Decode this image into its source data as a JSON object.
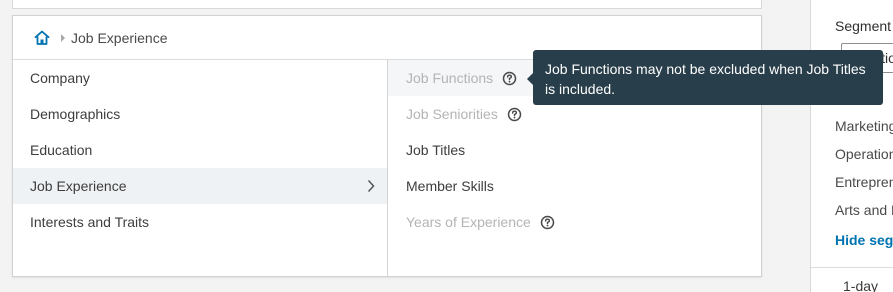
{
  "breadcrumb": {
    "home_icon": "home-icon",
    "separator_icon": "caret-right-icon",
    "current": "Job Experience"
  },
  "categories": [
    {
      "label": "Company",
      "selected": false
    },
    {
      "label": "Demographics",
      "selected": false
    },
    {
      "label": "Education",
      "selected": false
    },
    {
      "label": "Job Experience",
      "selected": true
    },
    {
      "label": "Interests and Traits",
      "selected": false
    }
  ],
  "subcategories": [
    {
      "label": "Job Functions",
      "disabled": true,
      "help_icon": true
    },
    {
      "label": "Job Seniorities",
      "disabled": true,
      "help_icon": true
    },
    {
      "label": "Job Titles",
      "disabled": false,
      "help_icon": false
    },
    {
      "label": "Member Skills",
      "disabled": false,
      "help_icon": false
    },
    {
      "label": "Years of Experience",
      "disabled": true,
      "help_icon": true
    }
  ],
  "tooltip": {
    "text": "Job Functions may not be excluded when Job Titles is included."
  },
  "side_panel": {
    "title": "Segment",
    "select_value": "Functio",
    "rows": [
      "s",
      "Marketing",
      "Operations",
      "Entrepreneurship",
      "Arts and Design"
    ],
    "link": "Hide segment",
    "footer": "1-day"
  },
  "colors": {
    "tooltip_bg": "#283e4a",
    "link": "#0073b1",
    "home_icon": "#0073b1",
    "selected_row": "#eff2f5"
  }
}
